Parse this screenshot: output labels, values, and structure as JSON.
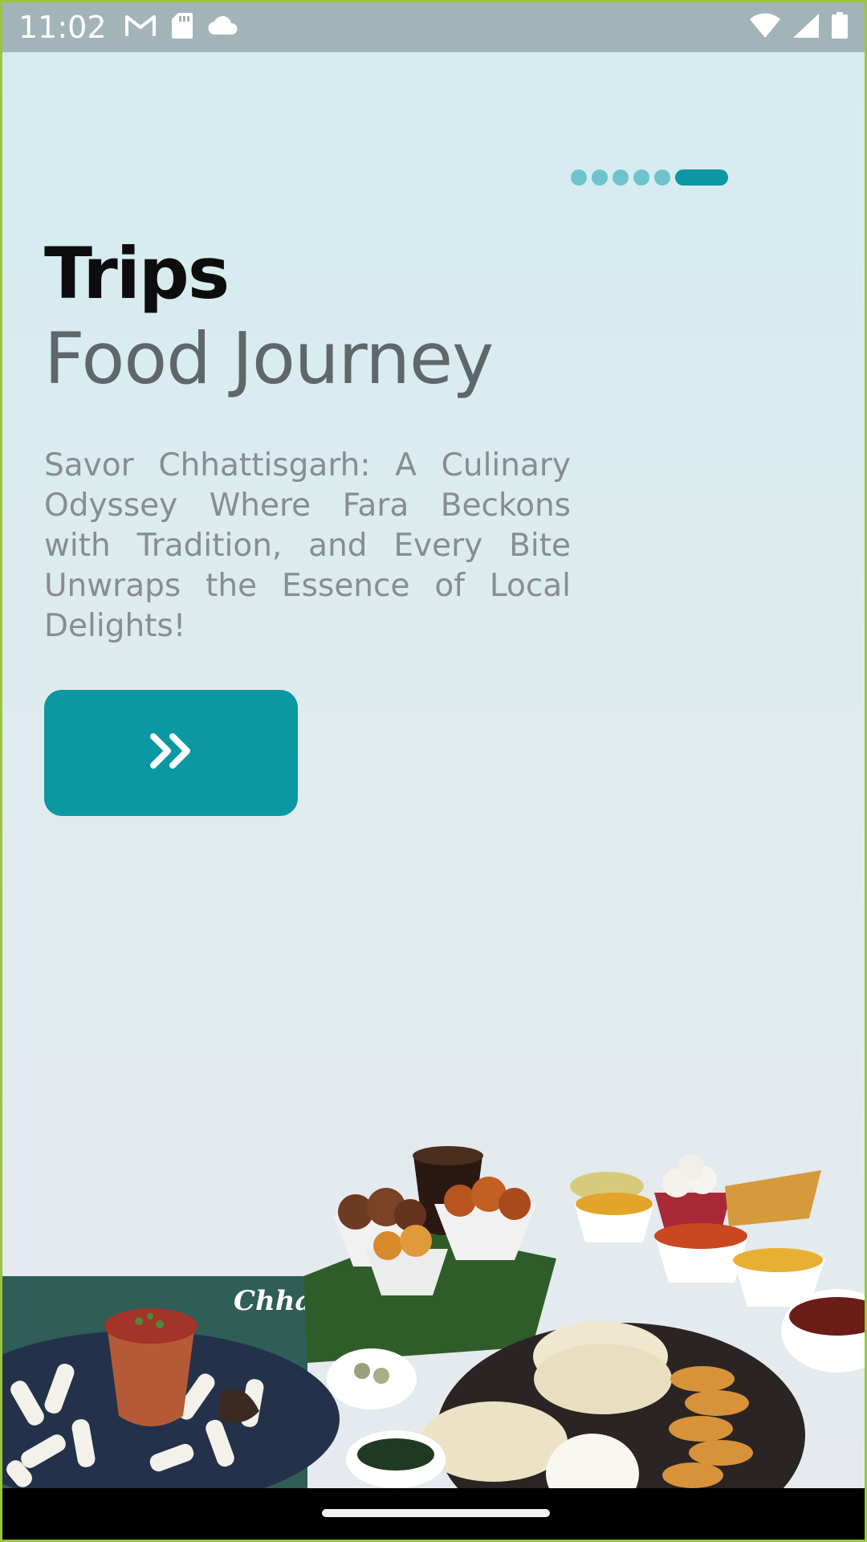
{
  "status_bar": {
    "time": "11:02",
    "left_icons": [
      "gmail-icon",
      "sd-card-icon",
      "cloud-icon"
    ],
    "right_icons": [
      "wifi-icon",
      "signal-icon",
      "battery-icon"
    ]
  },
  "onboarding": {
    "page_count": 6,
    "active_page": 6,
    "title_bold": "Trips",
    "title_light": "Food Journey",
    "description": "Savor Chhattisgarh: A Culinary Odyssey Where Fara Beckons with Tradition, and Every Bite Unwraps the Essence of Local Delights!",
    "next_icon": "double-chevron-right-icon"
  },
  "image": {
    "banner_text": "Chhatt"
  },
  "colors": {
    "accent": "#0a98a2",
    "dot_inactive": "#6dc4cc",
    "title": "#0d0d0d",
    "subtitle": "#5f6769",
    "body_text": "#878d90"
  }
}
